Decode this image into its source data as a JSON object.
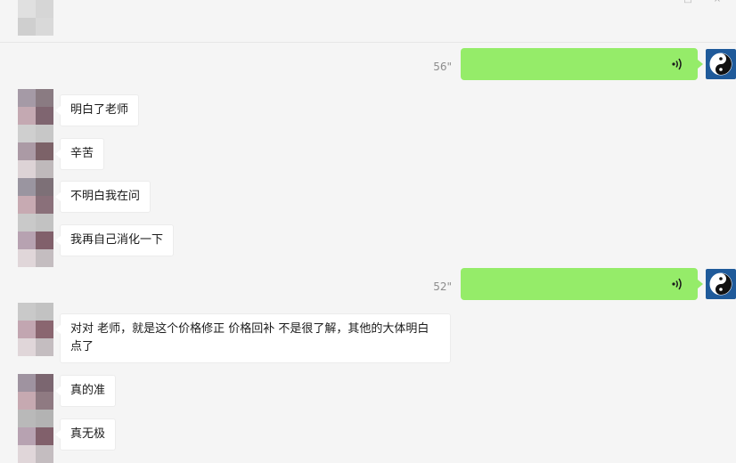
{
  "window": {
    "controls": [
      "-",
      "□",
      "×"
    ]
  },
  "messages": [
    {
      "type": "voice",
      "direction": "out",
      "duration": "56\""
    },
    {
      "type": "text",
      "direction": "in",
      "text": "明白了老师"
    },
    {
      "type": "text",
      "direction": "in",
      "text": "辛苦"
    },
    {
      "type": "text",
      "direction": "in",
      "text": "不明白我在问"
    },
    {
      "type": "text",
      "direction": "in",
      "text": "我再自己消化一下"
    },
    {
      "type": "voice",
      "direction": "out",
      "duration": "52\""
    },
    {
      "type": "text",
      "direction": "in",
      "text": "对对 老师，就是这个价格修正 价格回补 不是很了解，其他的大体明白点了"
    },
    {
      "type": "text",
      "direction": "in",
      "text": "真的准"
    },
    {
      "type": "text",
      "direction": "in",
      "text": "真无极"
    }
  ],
  "colors": {
    "background": "#f5f5f5",
    "outgoing_bubble": "#95ec69",
    "incoming_bubble": "#ffffff",
    "self_avatar": "#1f5a9a"
  },
  "icons": {
    "voice": "voice-wave-icon",
    "self_avatar": "yin-yang-icon",
    "contact_avatar": "pixelated-avatar"
  }
}
